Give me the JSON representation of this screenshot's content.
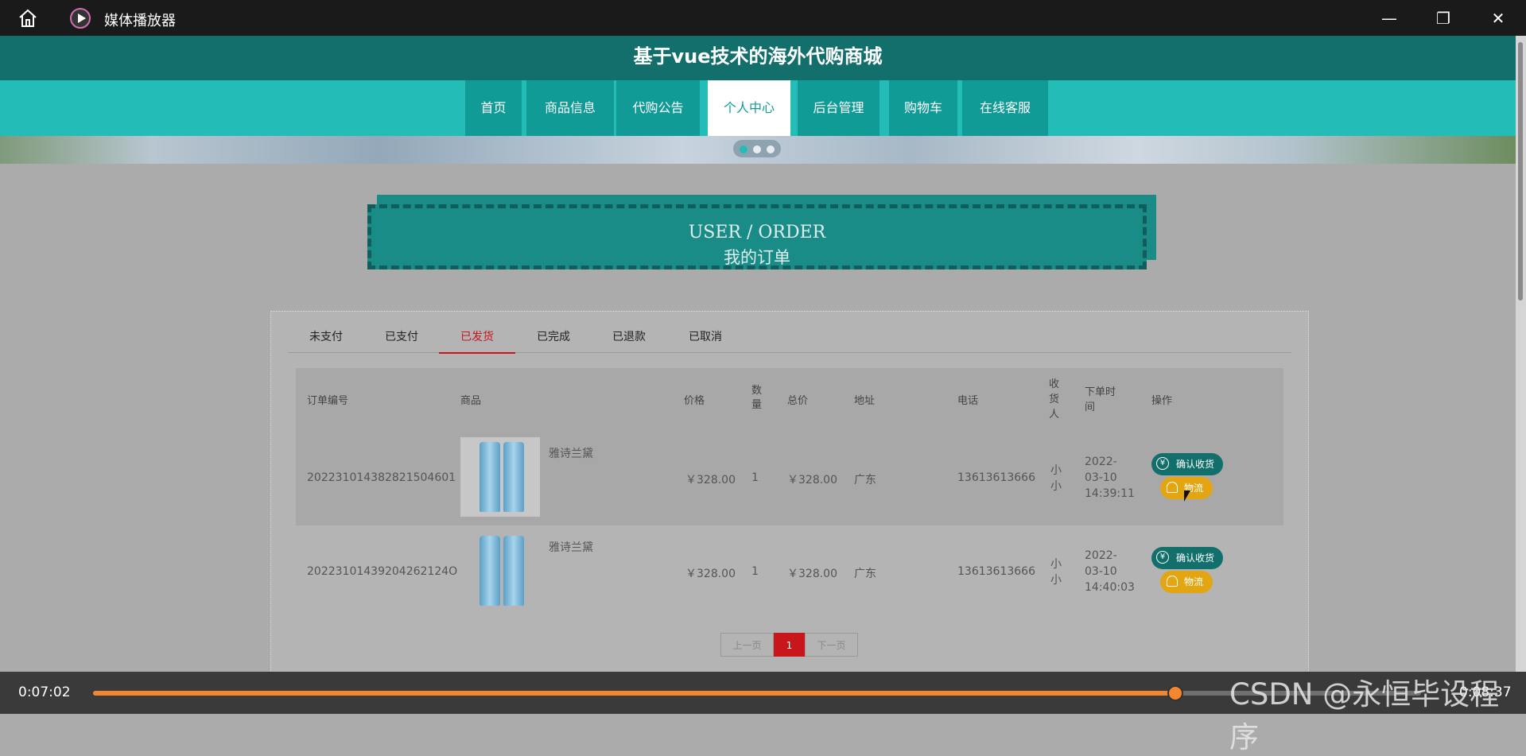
{
  "window": {
    "app_title": "媒体播放器",
    "minimize": "—",
    "restore": "❐",
    "close": "✕"
  },
  "site": {
    "title": "基于vue技术的海外代购商城"
  },
  "nav": [
    {
      "label": "首页"
    },
    {
      "label": "商品信息"
    },
    {
      "label": "代购公告"
    },
    {
      "label": "个人中心",
      "active": true
    },
    {
      "label": "后台管理"
    },
    {
      "label": "购物车"
    },
    {
      "label": "在线客服"
    }
  ],
  "order_banner": {
    "en": "USER / ORDER",
    "cn": "我的订单"
  },
  "tabs": [
    {
      "label": "未支付"
    },
    {
      "label": "已支付"
    },
    {
      "label": "已发货",
      "active": true
    },
    {
      "label": "已完成"
    },
    {
      "label": "已退款"
    },
    {
      "label": "已取消"
    }
  ],
  "table": {
    "headers": {
      "order_no": "订单编号",
      "product": "商品",
      "price": "价格",
      "qty": "数\n量",
      "total": "总价",
      "address": "地址",
      "phone": "电话",
      "receiver": "收\n货\n人",
      "order_time": "下单时\n间",
      "action": "操作"
    },
    "rows": [
      {
        "order_no": "202231014382821504601",
        "product_name": "雅诗兰黛",
        "price": "￥328.00",
        "qty": "1",
        "total": "￥328.00",
        "address": "广东",
        "phone": "13613613666",
        "receiver": "小\n小",
        "order_time": "2022-\n03-10\n14:39:11"
      },
      {
        "order_no": "20223101439204262124O",
        "product_name": "雅诗兰黛",
        "price": "￥328.00",
        "qty": "1",
        "total": "￥328.00",
        "address": "广东",
        "phone": "13613613666",
        "receiver": "小\n小",
        "order_time": "2022-\n03-10\n14:40:03"
      }
    ],
    "actions": {
      "confirm": "确认收货",
      "logistics": "物流",
      "currency_glyph": "¥"
    }
  },
  "pager": {
    "prev": "上一页",
    "current": "1",
    "next": "下一页"
  },
  "player": {
    "elapsed": "0:07:02",
    "duration": "0:08:37",
    "progress_fraction": 0.815
  },
  "watermark": "CSDN @永恒毕设程序",
  "colors": {
    "header": "#136f6b",
    "nav": "#24bcb6",
    "nav_item": "#119b97",
    "accent_red": "#c8161d",
    "progress": "#f3862f",
    "logistics": "#e3a511"
  }
}
